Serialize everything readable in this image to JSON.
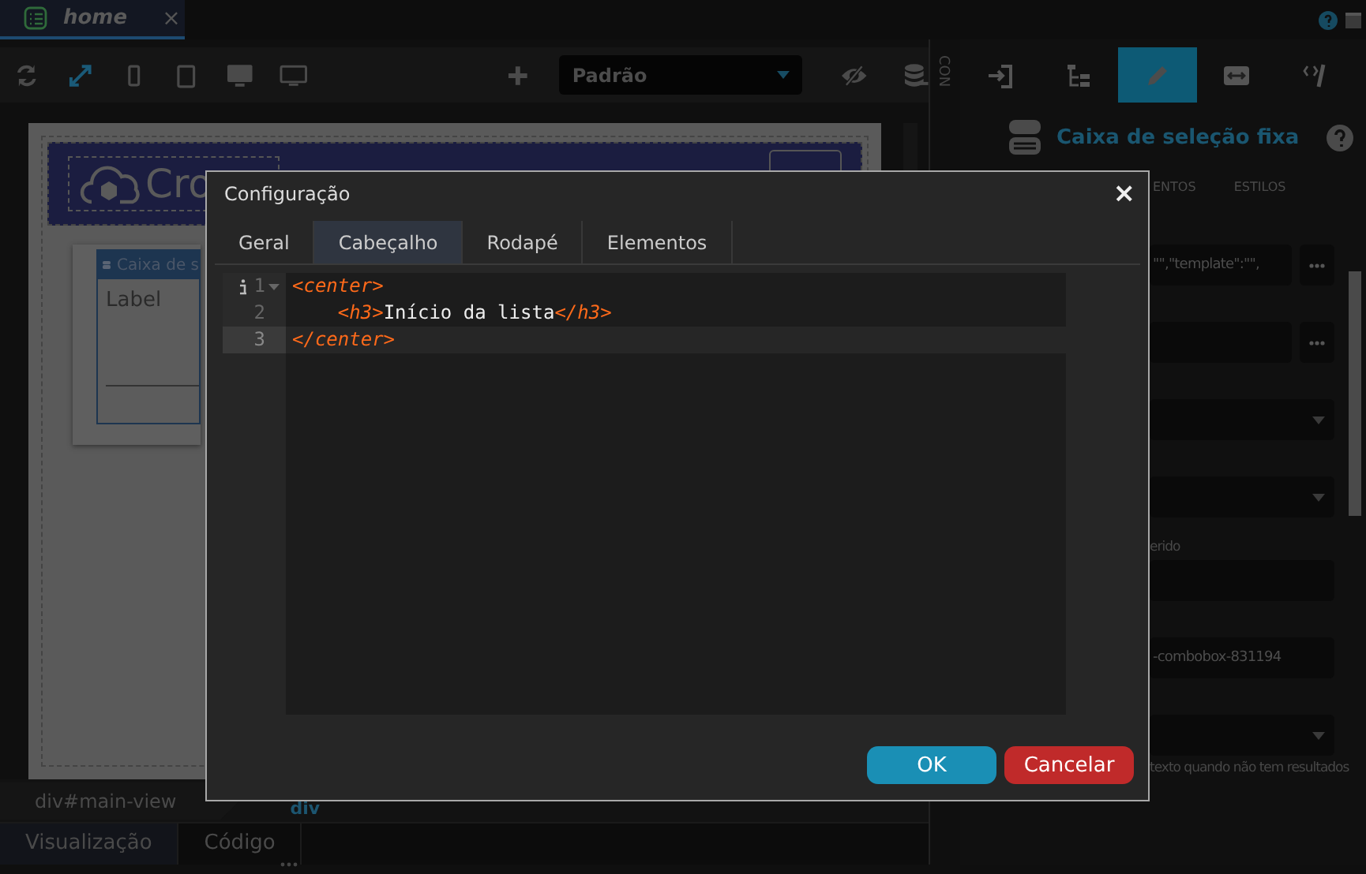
{
  "top_bar": {
    "tab": {
      "title": "home",
      "close": "×"
    }
  },
  "toolbar": {
    "devices": [
      {
        "kind": "refresh",
        "selected": false
      },
      {
        "kind": "expand",
        "selected": true
      },
      {
        "kind": "phone",
        "selected": false
      },
      {
        "kind": "tablet",
        "selected": false
      },
      {
        "kind": "desktop",
        "selected": false
      },
      {
        "kind": "monitor",
        "selected": false
      }
    ],
    "theme_select": {
      "value": "Padrão"
    }
  },
  "canvas": {
    "logo_text": "Cro",
    "component_title": "Caixa de s",
    "field_label": "Label"
  },
  "side_strip": {
    "label": "CON"
  },
  "right_panel": {
    "tools": [
      {
        "kind": "enter",
        "selected": false
      },
      {
        "kind": "tree",
        "selected": false
      },
      {
        "kind": "edit",
        "selected": true
      },
      {
        "kind": "resize",
        "selected": false
      },
      {
        "kind": "code",
        "selected": false
      }
    ],
    "title": "Caixa de seleção fixa",
    "tabs": [
      {
        "label": "ENTOS",
        "selected": false
      },
      {
        "label": "ESTILOS",
        "selected": false
      }
    ],
    "rows": [
      {
        "kind": "field_button",
        "value": "\"\",\"template\":\"\","
      },
      {
        "kind": "field_button"
      },
      {
        "kind": "select"
      },
      {
        "kind": "select"
      },
      {
        "kind": "label",
        "text": "erido"
      },
      {
        "kind": "field"
      },
      {
        "kind": "field",
        "value": "-combobox-831194"
      },
      {
        "kind": "select"
      },
      {
        "kind": "label",
        "text": "texto quando não tem resultados"
      }
    ]
  },
  "modal": {
    "title": "Configuração",
    "close": "×",
    "tabs": [
      {
        "label": "Geral",
        "selected": false
      },
      {
        "label": "Cabeçalho",
        "selected": true
      },
      {
        "label": "Rodapé",
        "selected": false
      },
      {
        "label": "Elementos",
        "selected": false
      }
    ],
    "editor": {
      "lines": [
        {
          "number": "1",
          "text": "<center>",
          "active": false,
          "info": true,
          "foldable": true
        },
        {
          "number": "2",
          "text": "    <h3>Início da lista</h3>",
          "active": false,
          "info": false,
          "foldable": false
        },
        {
          "number": "3",
          "text": "</center>",
          "active": true,
          "info": false,
          "foldable": false
        }
      ]
    },
    "buttons": [
      {
        "kind": "primary",
        "label": "OK"
      },
      {
        "kind": "danger",
        "label": "Cancelar"
      }
    ]
  },
  "bottom": {
    "breadcrumb": [
      {
        "label": "div#main-view",
        "selected": false
      },
      {
        "label": "div",
        "selected": true
      }
    ],
    "view_tabs": [
      {
        "label": "Visualização",
        "selected": true
      },
      {
        "label": "Código",
        "selected": false
      }
    ]
  }
}
